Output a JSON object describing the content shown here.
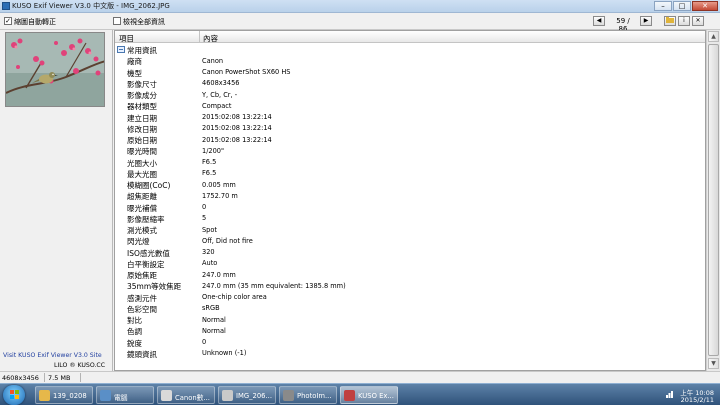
{
  "window": {
    "title": "KUSO Exif Viewer V3.0 中文版 - IMG_2062.JPG"
  },
  "toolbar": {
    "auto_rotate_label": "縮圖自動轉正",
    "auto_rotate_checked": "✓",
    "show_all_label": "檢視全部資訊",
    "page_counter": "59 / 86"
  },
  "table": {
    "header_item": "項目",
    "header_content": "內容",
    "group_label": "常用資訊",
    "rows": [
      {
        "name": "廠商",
        "value": "Canon"
      },
      {
        "name": "機型",
        "value": "Canon PowerShot SX60 HS"
      },
      {
        "name": "影像尺寸",
        "value": "4608x3456"
      },
      {
        "name": "影像成分",
        "value": "Y, Cb, Cr, -"
      },
      {
        "name": "器材類型",
        "value": "Compact"
      },
      {
        "name": "建立日期",
        "value": "2015:02:08 13:22:14"
      },
      {
        "name": "修改日期",
        "value": "2015:02:08 13:22:14"
      },
      {
        "name": "原始日期",
        "value": "2015:02:08 13:22:14"
      },
      {
        "name": "曝光時間",
        "value": "1/200\""
      },
      {
        "name": "光圈大小",
        "value": "F6.5"
      },
      {
        "name": "最大光圈",
        "value": "F6.5"
      },
      {
        "name": "模糊圈(CoC)",
        "value": "0.005 mm"
      },
      {
        "name": "超焦距離",
        "value": "1752.70 m"
      },
      {
        "name": "曝光補償",
        "value": "0"
      },
      {
        "name": "影像壓縮率",
        "value": "5"
      },
      {
        "name": "測光模式",
        "value": "Spot"
      },
      {
        "name": "閃光燈",
        "value": "Off, Did not fire"
      },
      {
        "name": "ISO感光數值",
        "value": "320"
      },
      {
        "name": "白平衡設定",
        "value": "Auto"
      },
      {
        "name": "原始焦距",
        "value": "247.0 mm"
      },
      {
        "name": "35mm等效焦距",
        "value": "247.0 mm (35 mm equivalent: 1385.8 mm)"
      },
      {
        "name": "感測元件",
        "value": "One-chip color area"
      },
      {
        "name": "色彩空間",
        "value": "sRGB"
      },
      {
        "name": "對比",
        "value": "Normal"
      },
      {
        "name": "色調",
        "value": "Normal"
      },
      {
        "name": "銳度",
        "value": "0"
      },
      {
        "name": "鏡頭資訊",
        "value": "Unknown (-1)"
      }
    ]
  },
  "left_panel": {
    "site_link": "Visit KUSO Exif Viewer V3.0 Site",
    "author": "LILO ® KUSO.CC"
  },
  "status": {
    "dimensions": "4608x3456",
    "file_size": "7.5 MB"
  },
  "taskbar": {
    "tasks": [
      {
        "label": "139_0208",
        "icon_color": "#e6b84a"
      },
      {
        "label": "電腦",
        "icon_color": "#5a8fc7"
      },
      {
        "label": "Canon數...",
        "icon_color": "#d9d9d9"
      },
      {
        "label": "IMG_206...",
        "icon_color": "#c9c9c9"
      },
      {
        "label": "PhotoIm...",
        "icon_color": "#8a8a8a"
      },
      {
        "label": "KUSO Ex...",
        "icon_color": "#c04040"
      }
    ],
    "clock_time": "上午 10:08",
    "clock_date": "2015/2/11"
  },
  "colors": {
    "taskbar": "#2f527a",
    "link": "#2240a0",
    "close_button": "#c44a36"
  }
}
